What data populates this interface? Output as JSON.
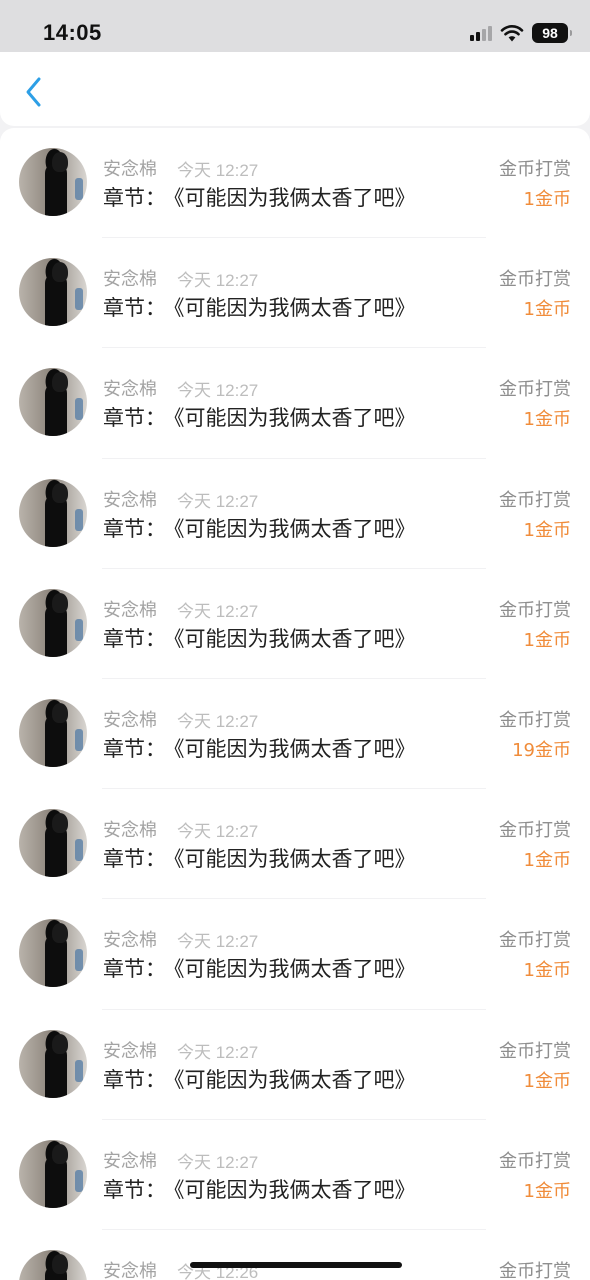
{
  "status_bar": {
    "time": "14:05",
    "battery": "98",
    "icons": [
      "cellular-signal-icon",
      "wifi-icon",
      "battery-icon"
    ]
  },
  "nav": {
    "back_icon": "chevron-left-icon",
    "accent_color": "#2d9fe6"
  },
  "colors": {
    "amount": "#f08c3a",
    "name": "#a3a3a3",
    "chapter": "#222222"
  },
  "records": [
    {
      "name": "安念棉",
      "time": "今天 12:27",
      "chapter_label": "章节：",
      "chapter_title": "《可能因为我俩太香了吧》",
      "tip_type": "金币打赏",
      "amount": "1金币"
    },
    {
      "name": "安念棉",
      "time": "今天 12:27",
      "chapter_label": "章节：",
      "chapter_title": "《可能因为我俩太香了吧》",
      "tip_type": "金币打赏",
      "amount": "1金币"
    },
    {
      "name": "安念棉",
      "time": "今天 12:27",
      "chapter_label": "章节：",
      "chapter_title": "《可能因为我俩太香了吧》",
      "tip_type": "金币打赏",
      "amount": "1金币"
    },
    {
      "name": "安念棉",
      "time": "今天 12:27",
      "chapter_label": "章节：",
      "chapter_title": "《可能因为我俩太香了吧》",
      "tip_type": "金币打赏",
      "amount": "1金币"
    },
    {
      "name": "安念棉",
      "time": "今天 12:27",
      "chapter_label": "章节：",
      "chapter_title": "《可能因为我俩太香了吧》",
      "tip_type": "金币打赏",
      "amount": "1金币"
    },
    {
      "name": "安念棉",
      "time": "今天 12:27",
      "chapter_label": "章节：",
      "chapter_title": "《可能因为我俩太香了吧》",
      "tip_type": "金币打赏",
      "amount": "19金币"
    },
    {
      "name": "安念棉",
      "time": "今天 12:27",
      "chapter_label": "章节：",
      "chapter_title": "《可能因为我俩太香了吧》",
      "tip_type": "金币打赏",
      "amount": "1金币"
    },
    {
      "name": "安念棉",
      "time": "今天 12:27",
      "chapter_label": "章节：",
      "chapter_title": "《可能因为我俩太香了吧》",
      "tip_type": "金币打赏",
      "amount": "1金币"
    },
    {
      "name": "安念棉",
      "time": "今天 12:27",
      "chapter_label": "章节：",
      "chapter_title": "《可能因为我俩太香了吧》",
      "tip_type": "金币打赏",
      "amount": "1金币"
    },
    {
      "name": "安念棉",
      "time": "今天 12:27",
      "chapter_label": "章节：",
      "chapter_title": "《可能因为我俩太香了吧》",
      "tip_type": "金币打赏",
      "amount": "1金币"
    },
    {
      "name": "安念棉",
      "time": "今天 12:26",
      "chapter_label": "",
      "chapter_title": "",
      "tip_type": "金币打赏",
      "amount": ""
    }
  ]
}
